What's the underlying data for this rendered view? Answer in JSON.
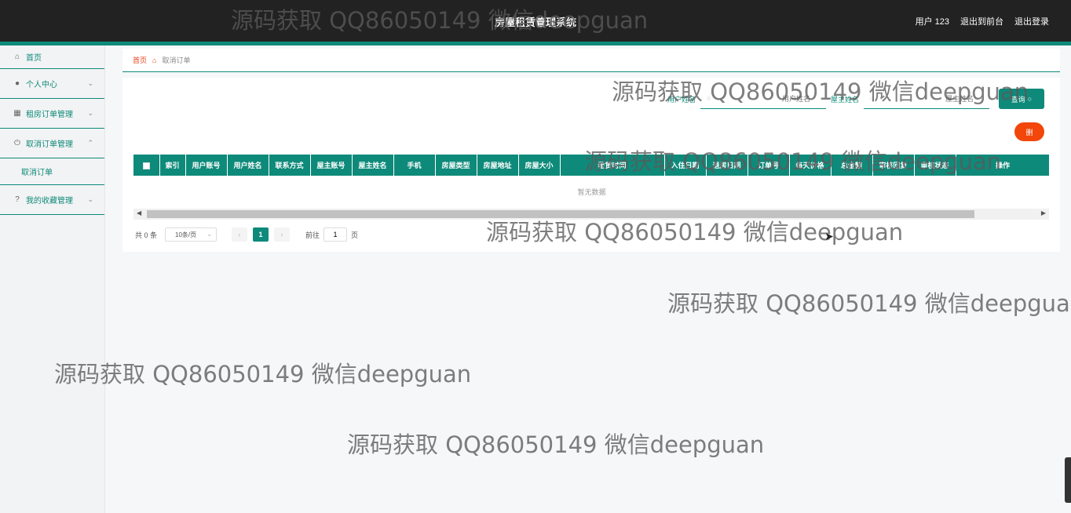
{
  "header": {
    "title": "房屋租赁管理系统",
    "user": "用户 123",
    "back_to_front": "退出到前台",
    "logout": "退出登录"
  },
  "sidebar": {
    "home": "首页",
    "personal": "个人中心",
    "rent_orders": "租房订单管理",
    "cancel_orders": "取消订单管理",
    "cancel_orders_sub": "取消订单",
    "favorites": "我的收藏管理"
  },
  "breadcrumb": {
    "home": "首页",
    "current": "取消订单"
  },
  "search": {
    "user_name_label": "用户姓名",
    "user_name_placeholder": "用户姓名",
    "owner_name_label": "屋主姓名",
    "owner_name_placeholder": "屋主姓名",
    "query_button": "查询"
  },
  "delete_button": "删",
  "table": {
    "headers": [
      "索引",
      "用户账号",
      "用户姓名",
      "联系方式",
      "屋主账号",
      "屋主姓名",
      "手机",
      "房屋类型",
      "房屋地址",
      "房屋大小",
      "租赁时间",
      "入住日期",
      "退房日期",
      "订单号",
      "每天价格",
      "总金额",
      "审核回复",
      "审核状态",
      "操作"
    ],
    "empty_text": "暂无数据"
  },
  "pagination": {
    "total": "共 0 条",
    "page_size": "10条/页",
    "current_page": "1",
    "goto_prefix": "前往",
    "goto_value": "1",
    "goto_suffix": "页"
  },
  "watermark": "源码获取 QQ86050149 微信deepguan",
  "colors": {
    "accent": "#0e8a7a",
    "danger": "#f2460a",
    "header_bg": "#222222"
  }
}
